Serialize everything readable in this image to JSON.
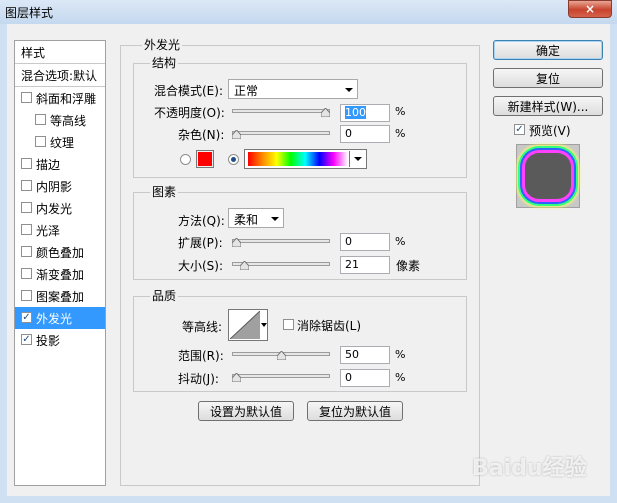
{
  "window": {
    "title": "图层样式",
    "close_icon": "×"
  },
  "sidebar": {
    "header": "样式",
    "items": [
      {
        "label": "混合选项:默认",
        "checkbox": false,
        "checked": false,
        "indent": false,
        "selected": false
      },
      {
        "label": "斜面和浮雕",
        "checkbox": true,
        "checked": false,
        "indent": false,
        "selected": false
      },
      {
        "label": "等高线",
        "checkbox": true,
        "checked": false,
        "indent": true,
        "selected": false
      },
      {
        "label": "纹理",
        "checkbox": true,
        "checked": false,
        "indent": true,
        "selected": false
      },
      {
        "label": "描边",
        "checkbox": true,
        "checked": false,
        "indent": false,
        "selected": false
      },
      {
        "label": "内阴影",
        "checkbox": true,
        "checked": false,
        "indent": false,
        "selected": false
      },
      {
        "label": "内发光",
        "checkbox": true,
        "checked": false,
        "indent": false,
        "selected": false
      },
      {
        "label": "光泽",
        "checkbox": true,
        "checked": false,
        "indent": false,
        "selected": false
      },
      {
        "label": "颜色叠加",
        "checkbox": true,
        "checked": false,
        "indent": false,
        "selected": false
      },
      {
        "label": "渐变叠加",
        "checkbox": true,
        "checked": false,
        "indent": false,
        "selected": false
      },
      {
        "label": "图案叠加",
        "checkbox": true,
        "checked": false,
        "indent": false,
        "selected": false
      },
      {
        "label": "外发光",
        "checkbox": true,
        "checked": true,
        "indent": false,
        "selected": true
      },
      {
        "label": "投影",
        "checkbox": true,
        "checked": true,
        "indent": false,
        "selected": false
      }
    ]
  },
  "outer_glow": {
    "title": "外发光",
    "structure": {
      "title": "结构",
      "blend_mode_label": "混合模式(E):",
      "blend_mode_value": "正常",
      "opacity_label": "不透明度(O):",
      "opacity_value": "100",
      "opacity_unit": "%",
      "opacity_level": 1.0,
      "noise_label": "杂色(N):",
      "noise_value": "0",
      "noise_unit": "%",
      "noise_level": 0.0,
      "color_swatch": "#ff0000"
    },
    "elements": {
      "title": "图素",
      "technique_label": "方法(Q):",
      "technique_value": "柔和",
      "spread_label": "扩展(P):",
      "spread_value": "0",
      "spread_unit": "%",
      "spread_level": 0.0,
      "size_label": "大小(S):",
      "size_value": "21",
      "size_unit": "像素",
      "size_level": 0.085
    },
    "quality": {
      "title": "品质",
      "contour_label": "等高线:",
      "antialias_label": "消除锯齿(L)",
      "range_label": "范围(R):",
      "range_value": "50",
      "range_unit": "%",
      "range_level": 0.5,
      "jitter_label": "抖动(J):",
      "jitter_value": "0",
      "jitter_unit": "%",
      "jitter_level": 0.0
    },
    "make_default": "设置为默认值",
    "reset_default": "复位为默认值"
  },
  "buttons": {
    "ok": "确定",
    "reset": "复位",
    "new_style": "新建样式(W)...",
    "preview": "预览(V)"
  },
  "watermark": "Baidu经验"
}
